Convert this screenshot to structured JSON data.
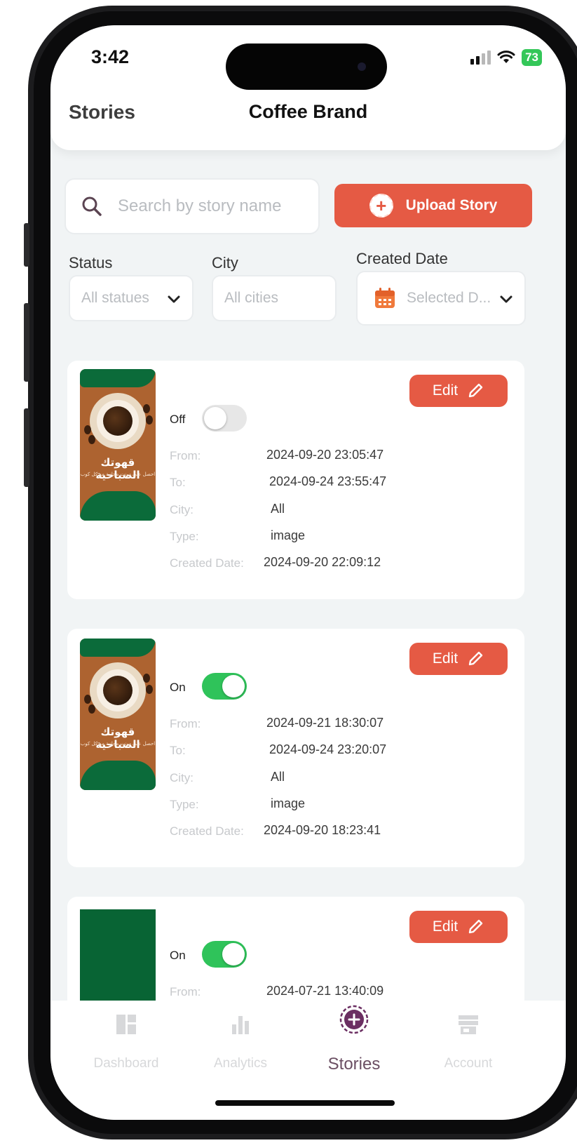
{
  "status_bar": {
    "time": "3:42",
    "battery": "73"
  },
  "header": {
    "section": "Stories",
    "brand": "Coffee Brand"
  },
  "search": {
    "placeholder": "Search by story name"
  },
  "upload_button": {
    "label": "Upload Story"
  },
  "filters": {
    "status": {
      "label": "Status",
      "value": "All statues"
    },
    "city": {
      "label": "City",
      "value": "All cities"
    },
    "created_date": {
      "label": "Created Date",
      "value": "Selected D..."
    }
  },
  "row_labels": {
    "from": "From:",
    "to": "To:",
    "city": "City:",
    "type": "Type:",
    "created": "Created Date:"
  },
  "stories": [
    {
      "edit_label": "Edit",
      "toggle_label": "Off",
      "enabled": false,
      "thumbnail_title": "قهوتك الصباحية",
      "thumbnail_subtitle": "احصل على دونت مجانية مع كل كوب",
      "from": "2024-09-20 23:05:47",
      "to": "2024-09-24 23:55:47",
      "city": "All",
      "type": "image",
      "created": "2024-09-20 22:09:12"
    },
    {
      "edit_label": "Edit",
      "toggle_label": "On",
      "enabled": true,
      "thumbnail_title": "قهوتك الصباحية",
      "thumbnail_subtitle": "احصل على دونت مجانية مع كل كوب",
      "from": "2024-09-21 18:30:07",
      "to": "2024-09-24 23:20:07",
      "city": "All",
      "type": "image",
      "created": "2024-09-20 18:23:41"
    },
    {
      "edit_label": "Edit",
      "toggle_label": "On",
      "enabled": true,
      "from": "2024-07-21 13:40:09"
    }
  ],
  "nav": {
    "items": [
      {
        "label": "Dashboard",
        "icon": "dashboard-icon"
      },
      {
        "label": "Analytics",
        "icon": "bar-chart-icon"
      },
      {
        "label": "Stories",
        "icon": "add-story-icon",
        "active": true
      },
      {
        "label": "Account",
        "icon": "store-icon"
      }
    ]
  },
  "colors": {
    "accent": "#e55a44",
    "toggle_on": "#2fc35a",
    "brand_green": "#0b6b3a",
    "nav_active": "#6b4f63"
  }
}
